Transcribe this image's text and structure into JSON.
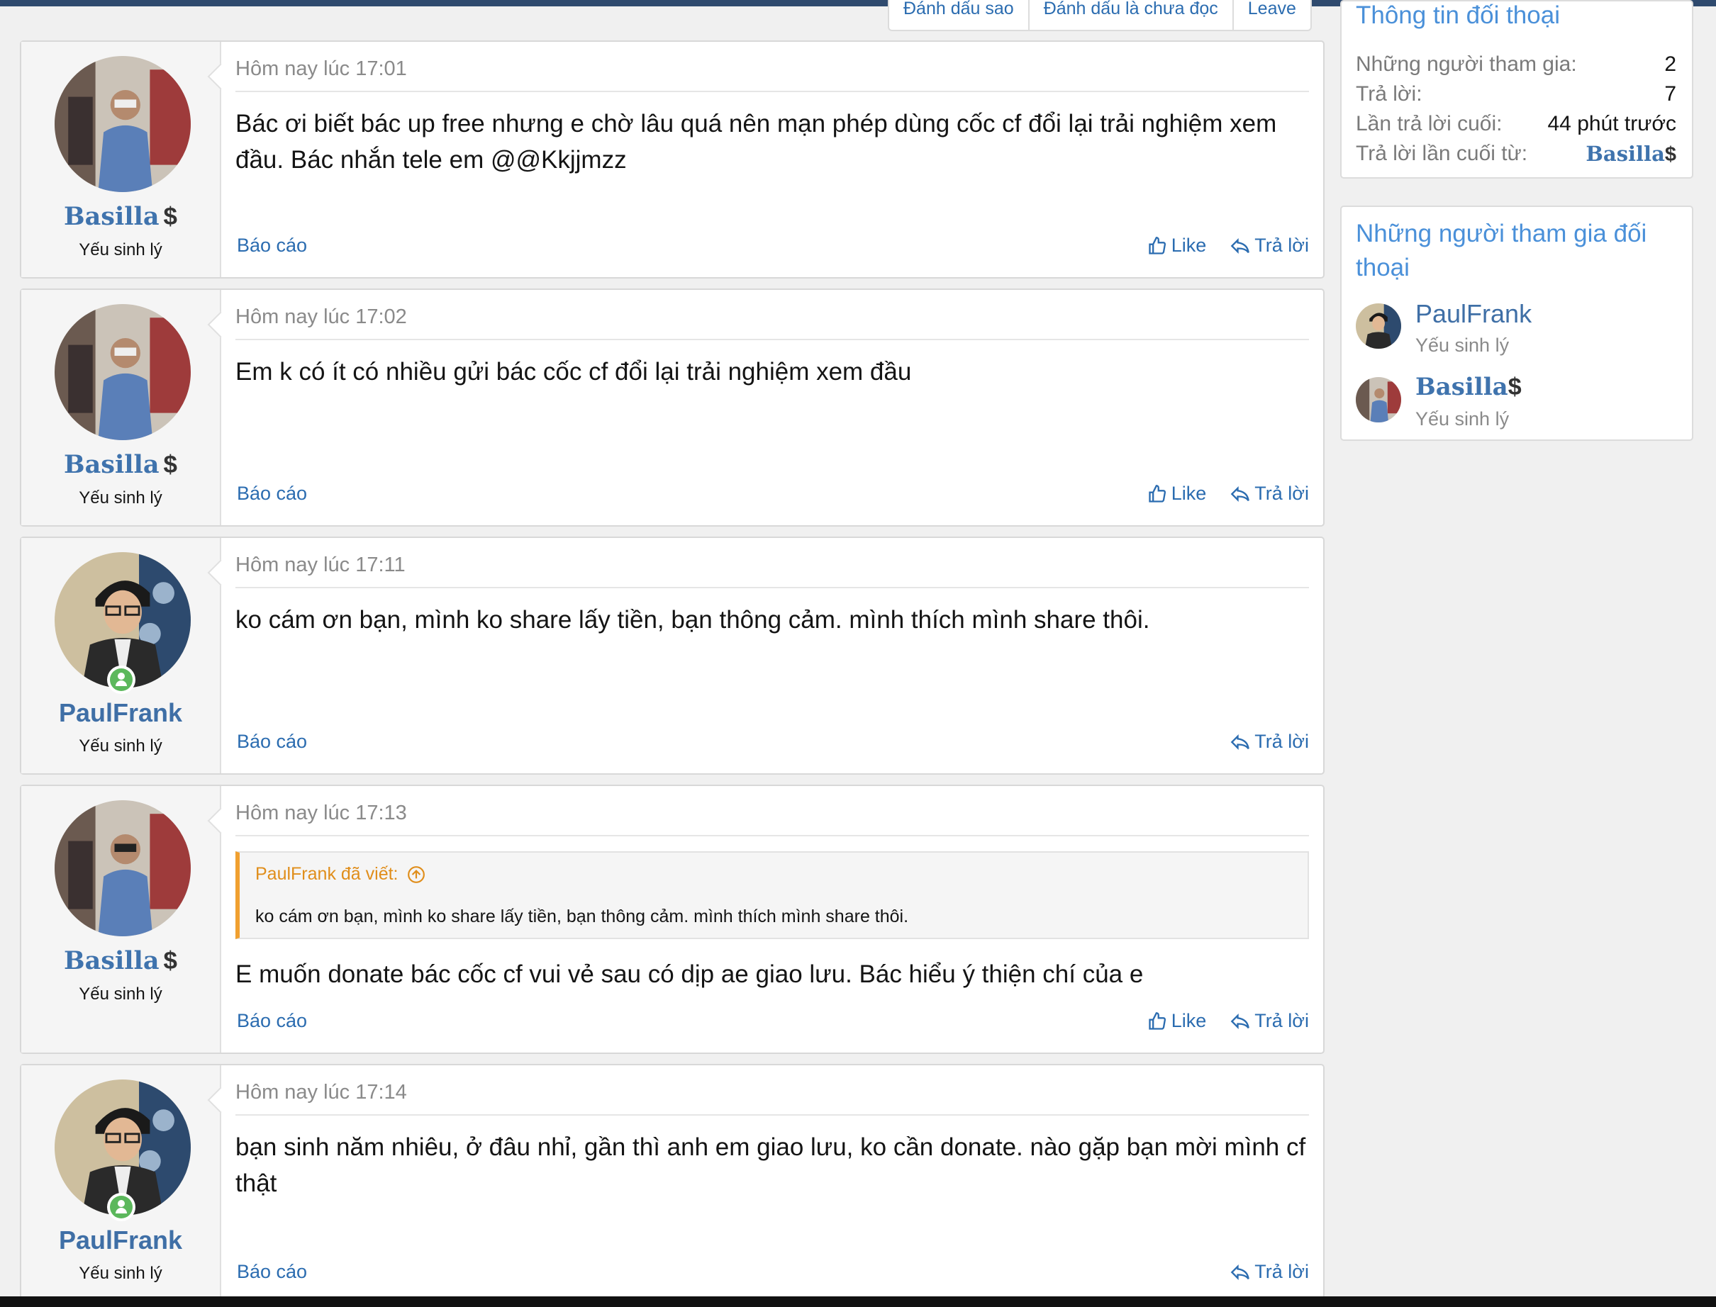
{
  "action_tabs": [
    "Đánh dấu sao",
    "Đánh dấu là chưa đọc",
    "Leave"
  ],
  "messages": [
    {
      "user": "Basilla",
      "user_suffix": "$",
      "title": "Yếu sinh lý",
      "time": "Hôm nay lúc 17:01",
      "text": "Bác ơi biết bác up free nhưng e chờ lâu quá nên mạn phép dùng cốc cf đổi lại trải nghiệm xem đầu. Bác nhắn tele em @@Kkjjmzz",
      "report": "Báo cáo",
      "like": "Like",
      "reply": "Trả lời"
    },
    {
      "user": "Basilla",
      "user_suffix": "$",
      "title": "Yếu sinh lý",
      "time": "Hôm nay lúc 17:02",
      "text": "Em k có ít có nhiều gửi bác cốc cf đổi lại trải nghiệm xem đầu",
      "report": "Báo cáo",
      "like": "Like",
      "reply": "Trả lời"
    },
    {
      "user": "PaulFrank",
      "title": "Yếu sinh lý",
      "time": "Hôm nay lúc 17:11",
      "text": "ko cám ơn bạn, mình ko share lấy tiền, bạn thông cảm. mình thích mình share thôi.",
      "report": "Báo cáo",
      "reply": "Trả lời"
    },
    {
      "user": "Basilla",
      "user_suffix": "$",
      "title": "Yếu sinh lý",
      "time": "Hôm nay lúc 17:13",
      "quote_author": "PaulFrank đã viết:",
      "quote_text": "ko cám ơn bạn, mình ko share lấy tiền, bạn thông cảm. mình thích mình share thôi.",
      "text": "E muốn donate bác cốc cf vui vẻ sau có dịp ae giao lưu. Bác hiểu ý thiện chí của e",
      "report": "Báo cáo",
      "like": "Like",
      "reply": "Trả lời"
    },
    {
      "user": "PaulFrank",
      "title": "Yếu sinh lý",
      "time": "Hôm nay lúc 17:14",
      "text": "bạn sinh năm nhiêu, ở đâu nhỉ, gần thì anh em giao lưu, ko cần donate. nào gặp bạn mời mình cf thật",
      "report": "Báo cáo",
      "reply": "Trả lời"
    }
  ],
  "sidebar": {
    "info": {
      "title": "Thông tin đối thoại",
      "rows": [
        {
          "label": "Những người tham gia:",
          "value": "2"
        },
        {
          "label": "Trả lời:",
          "value": "7"
        },
        {
          "label": "Lần trả lời cuối:",
          "value": "44 phút trước"
        },
        {
          "label": "Trả lời lần cuối từ:",
          "value": "Basilla",
          "suffix": "$"
        }
      ]
    },
    "participants": {
      "title": "Những người tham gia đối thoại",
      "list": [
        {
          "name": "PaulFrank",
          "title": "Yếu sinh lý"
        },
        {
          "name": "Basilla",
          "suffix": "$",
          "title": "Yếu sinh lý"
        }
      ]
    }
  }
}
